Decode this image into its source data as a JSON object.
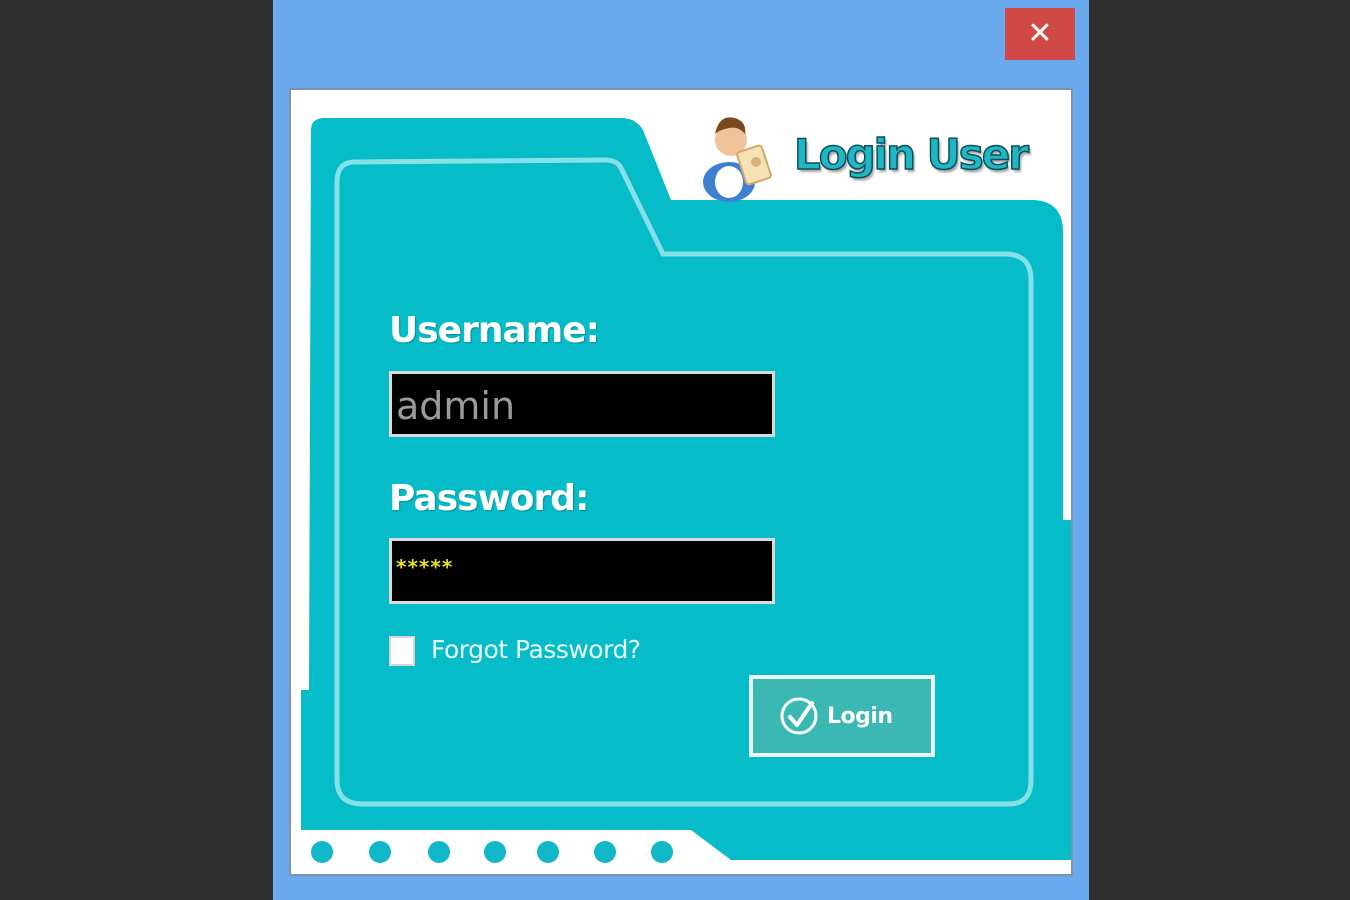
{
  "window": {
    "close_glyph": "✕"
  },
  "header": {
    "title": "Login User",
    "logo_icon": "user-key-icon"
  },
  "form": {
    "username_label": "Username:",
    "username_value": "admin",
    "password_label": "Password:",
    "password_mask": "*****",
    "forgot_label": "Forgot Password?",
    "forgot_checked": false,
    "login_label": "Login",
    "login_icon": "check-circle-icon"
  },
  "colors": {
    "frame": "#6aa9ee",
    "folder": "#06bcc9",
    "close": "#cf4a47",
    "field_bg": "#000000",
    "password_text": "#e6e02a"
  }
}
